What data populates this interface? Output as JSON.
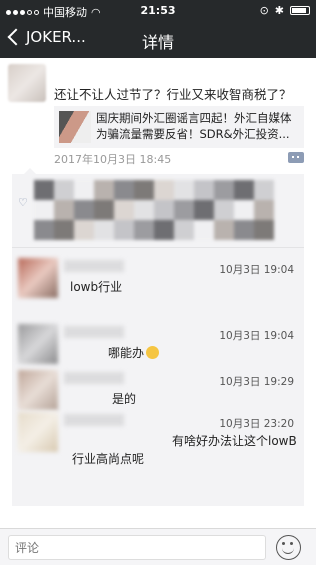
{
  "status_bar": {
    "carrier": "中国移动",
    "time": "21:53",
    "wifi_icon": "wifi-icon",
    "battery_icon": "battery-icon"
  },
  "nav": {
    "back_label": "JOKER...",
    "title": "详情"
  },
  "post": {
    "text": "还让不让人过节了？行业又来收智商税了？",
    "link_title": "国庆期间外汇圈谣言四起！外汇自媒体为骗流量需要反省！SDR&外汇投资...",
    "time": "2017年10月3日 18:45"
  },
  "comments": [
    {
      "time": "10月3日 19:04",
      "text": "lowb行业"
    },
    {
      "time": "10月3日 19:04",
      "text": "哪能办"
    },
    {
      "time": "10月3日 19:29",
      "text": "是的"
    },
    {
      "time": "10月3日 23:20",
      "text": "有啥好办法让这个lowB行业高尚点呢"
    }
  ],
  "input": {
    "placeholder": "评论"
  },
  "colors": {
    "nav_bg": "#26292b",
    "comment_bg": "#f3f3f5",
    "link_blue": "#576b95"
  }
}
